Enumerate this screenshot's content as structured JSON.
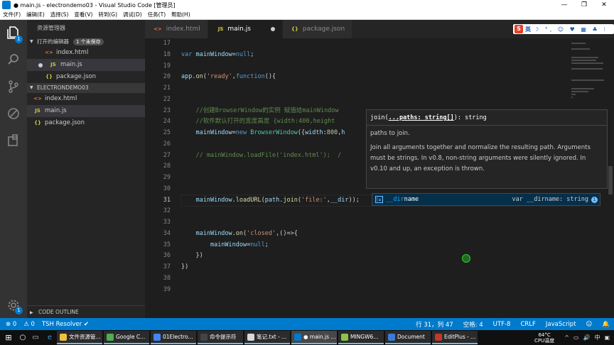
{
  "window": {
    "title": "● main.js - electrondemo03 - Visual Studio Code [管理员]",
    "controls": [
      "—",
      "❐",
      "✕"
    ]
  },
  "menu": [
    "文件(F)",
    "编辑(E)",
    "选择(S)",
    "查看(V)",
    "转到(G)",
    "调试(D)",
    "任务(T)",
    "帮助(H)"
  ],
  "activity_badges": {
    "explorer": "1",
    "settings": "1"
  },
  "sidebar": {
    "title": "资源管理器",
    "open_editors": {
      "label": "打开的编辑器",
      "badge": "1 个未保存"
    },
    "open_files": [
      {
        "name": "index.html",
        "icon": "<>",
        "type": "html"
      },
      {
        "name": "main.js",
        "icon": "JS",
        "type": "js",
        "dirty": true
      },
      {
        "name": "package.json",
        "icon": "{}",
        "type": "json"
      }
    ],
    "project": {
      "label": "ELECTRONDEMO03"
    },
    "project_files": [
      {
        "name": "index.html",
        "icon": "<>",
        "type": "html"
      },
      {
        "name": "main.js",
        "icon": "JS",
        "type": "js"
      },
      {
        "name": "package.json",
        "icon": "{}",
        "type": "json"
      }
    ],
    "outline_label": "CODE OUTLINE"
  },
  "tabs": [
    {
      "label": "index.html",
      "icon": "<>",
      "type": "html"
    },
    {
      "label": "main.js",
      "icon": "JS",
      "type": "js",
      "active": true
    },
    {
      "label": "package.json",
      "icon": "{}",
      "type": "json"
    }
  ],
  "ime": {
    "logo": "S",
    "mode": "英",
    "glyphs": "☽ °, ☺ ♥ ▦ ♣ ⁝"
  },
  "editor": {
    "line_numbers": [
      "17",
      "18",
      "19",
      "20",
      "21",
      "22",
      "23",
      "24",
      "25",
      "26",
      "27",
      "28",
      "29",
      "30",
      "31",
      "32",
      "33",
      "34",
      "35",
      "36",
      "37",
      "38",
      "39"
    ],
    "current_line": "31",
    "lines": [
      "",
      "var mainWindow=null;",
      "",
      "app.on('ready',function(){",
      "",
      "",
      "    //创建BrowserWindow的实例 赋值给mainWindow",
      "    //软件默认打开的宽度高度 {width:400,height",
      "    mainWindow=new BrowserWindow({width:800,h",
      "",
      "    // mainWindow.loadFile('index.html');  /",
      "",
      "",
      "",
      "    mainWindow.loadURL(path.join('file:',__dir));",
      "",
      "",
      "    mainWindow.on('closed',()=>{",
      "        mainWindow=null;",
      "    })",
      "})",
      "",
      ""
    ]
  },
  "hover": {
    "signature_prefix": "join(",
    "signature_param": "...paths: string[]",
    "signature_suffix": "): string",
    "param_doc": "paths to join.",
    "description": "Join all arguments together and normalize the resulting path. Arguments must be strings. In v0.8, non-string arguments were silently ignored. In v0.10 and up, an exception is thrown."
  },
  "suggest": {
    "kind": "[ω]",
    "label_match": "__dir",
    "label_rest": "name",
    "detail": "var __dirname: string",
    "info": "i"
  },
  "statusbar": {
    "errors": "⊗ 0",
    "warnings": "⚠ 0",
    "resolver": "TSH Resolver ✔",
    "position": "行 31，列 47",
    "indent": "空格: 4",
    "encoding": "UTF-8",
    "eol": "CRLF",
    "language": "JavaScript",
    "feedback": "☺",
    "notifications": "🔔"
  },
  "taskbar": {
    "apps": [
      {
        "label": "文件资源管...",
        "color": "#f0c040"
      },
      {
        "label": "Google C...",
        "color": "#4caf50"
      },
      {
        "label": "01Electro...",
        "color": "#4285f4"
      },
      {
        "label": "命令提示符",
        "color": "#444444"
      },
      {
        "label": "笔记.txt - ...",
        "color": "#d9d9d9"
      },
      {
        "label": "● main.js ...",
        "color": "#007acc",
        "active": true
      },
      {
        "label": "MINGW6...",
        "color": "#8bc34a"
      },
      {
        "label": "Document",
        "color": "#3a7bd5"
      },
      {
        "label": "EditPlus - ...",
        "color": "#c0392b"
      }
    ],
    "temp": "64°C",
    "temp_label": "CPU温度",
    "tray_icons": [
      "^",
      "▭",
      "🔊",
      "中",
      "▣"
    ]
  }
}
